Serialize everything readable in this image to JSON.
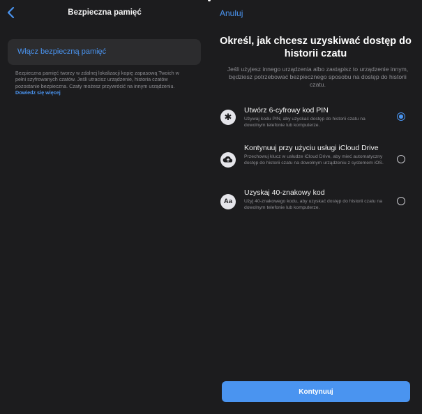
{
  "left": {
    "title": "Bezpieczna pamięć",
    "toggle_label": "Włącz bezpieczną pamięć",
    "info_text": "Bezpieczna pamięć tworzy w zdalnej lokalizacji kopię zapasową Twoich w pełni szyfrowanych czatów. Jeśli utracisz urządzenie, historia czatów pozostanie bezpieczna. Czaty możesz przywrócić na innym urządzeniu.",
    "info_link": "Dowiedz się więcej"
  },
  "right": {
    "cancel_label": "Anuluj",
    "heading": "Określ, jak chcesz uzyskiwać dostęp do historii czatu",
    "subtext": "Jeśli użyjesz innego urządzenia albo zastąpisz to urządzenie innym, będziesz potrzebować bezpiecznego sposobu na dostęp do historii czatu.",
    "options": [
      {
        "icon_name": "asterisk-icon",
        "icon_glyph": "✱",
        "title": "Utwórz 6-cyfrowy kod PIN",
        "desc": "Używaj kodu PIN, aby uzyskać dostęp do historii czatu na dowolnym telefonie lub komputerze.",
        "selected": true
      },
      {
        "icon_name": "cloud-upload-icon",
        "icon_glyph": "",
        "title": "Kontynuuj przy użyciu usługi iCloud Drive",
        "desc": "Przechowuj klucz w usłudze iCloud Drive, aby mieć automatyczny dostęp do historii czatu na dowolnym urządzeniu z systemem iOS.",
        "selected": false
      },
      {
        "icon_name": "text-aa-icon",
        "icon_glyph": "Aa",
        "title": "Uzyskaj 40-znakowy kod",
        "desc": "Użyj 40-znakowego kodu, aby uzyskać dostęp do historii czatu na dowolnym telefonie lub komputerze.",
        "selected": false
      }
    ],
    "continue_label": "Kontynuuj"
  },
  "colors": {
    "background": "#1c1c1e",
    "card": "#2c2c2e",
    "accent": "#4a94f0",
    "secondary_text": "#8e8e93"
  }
}
